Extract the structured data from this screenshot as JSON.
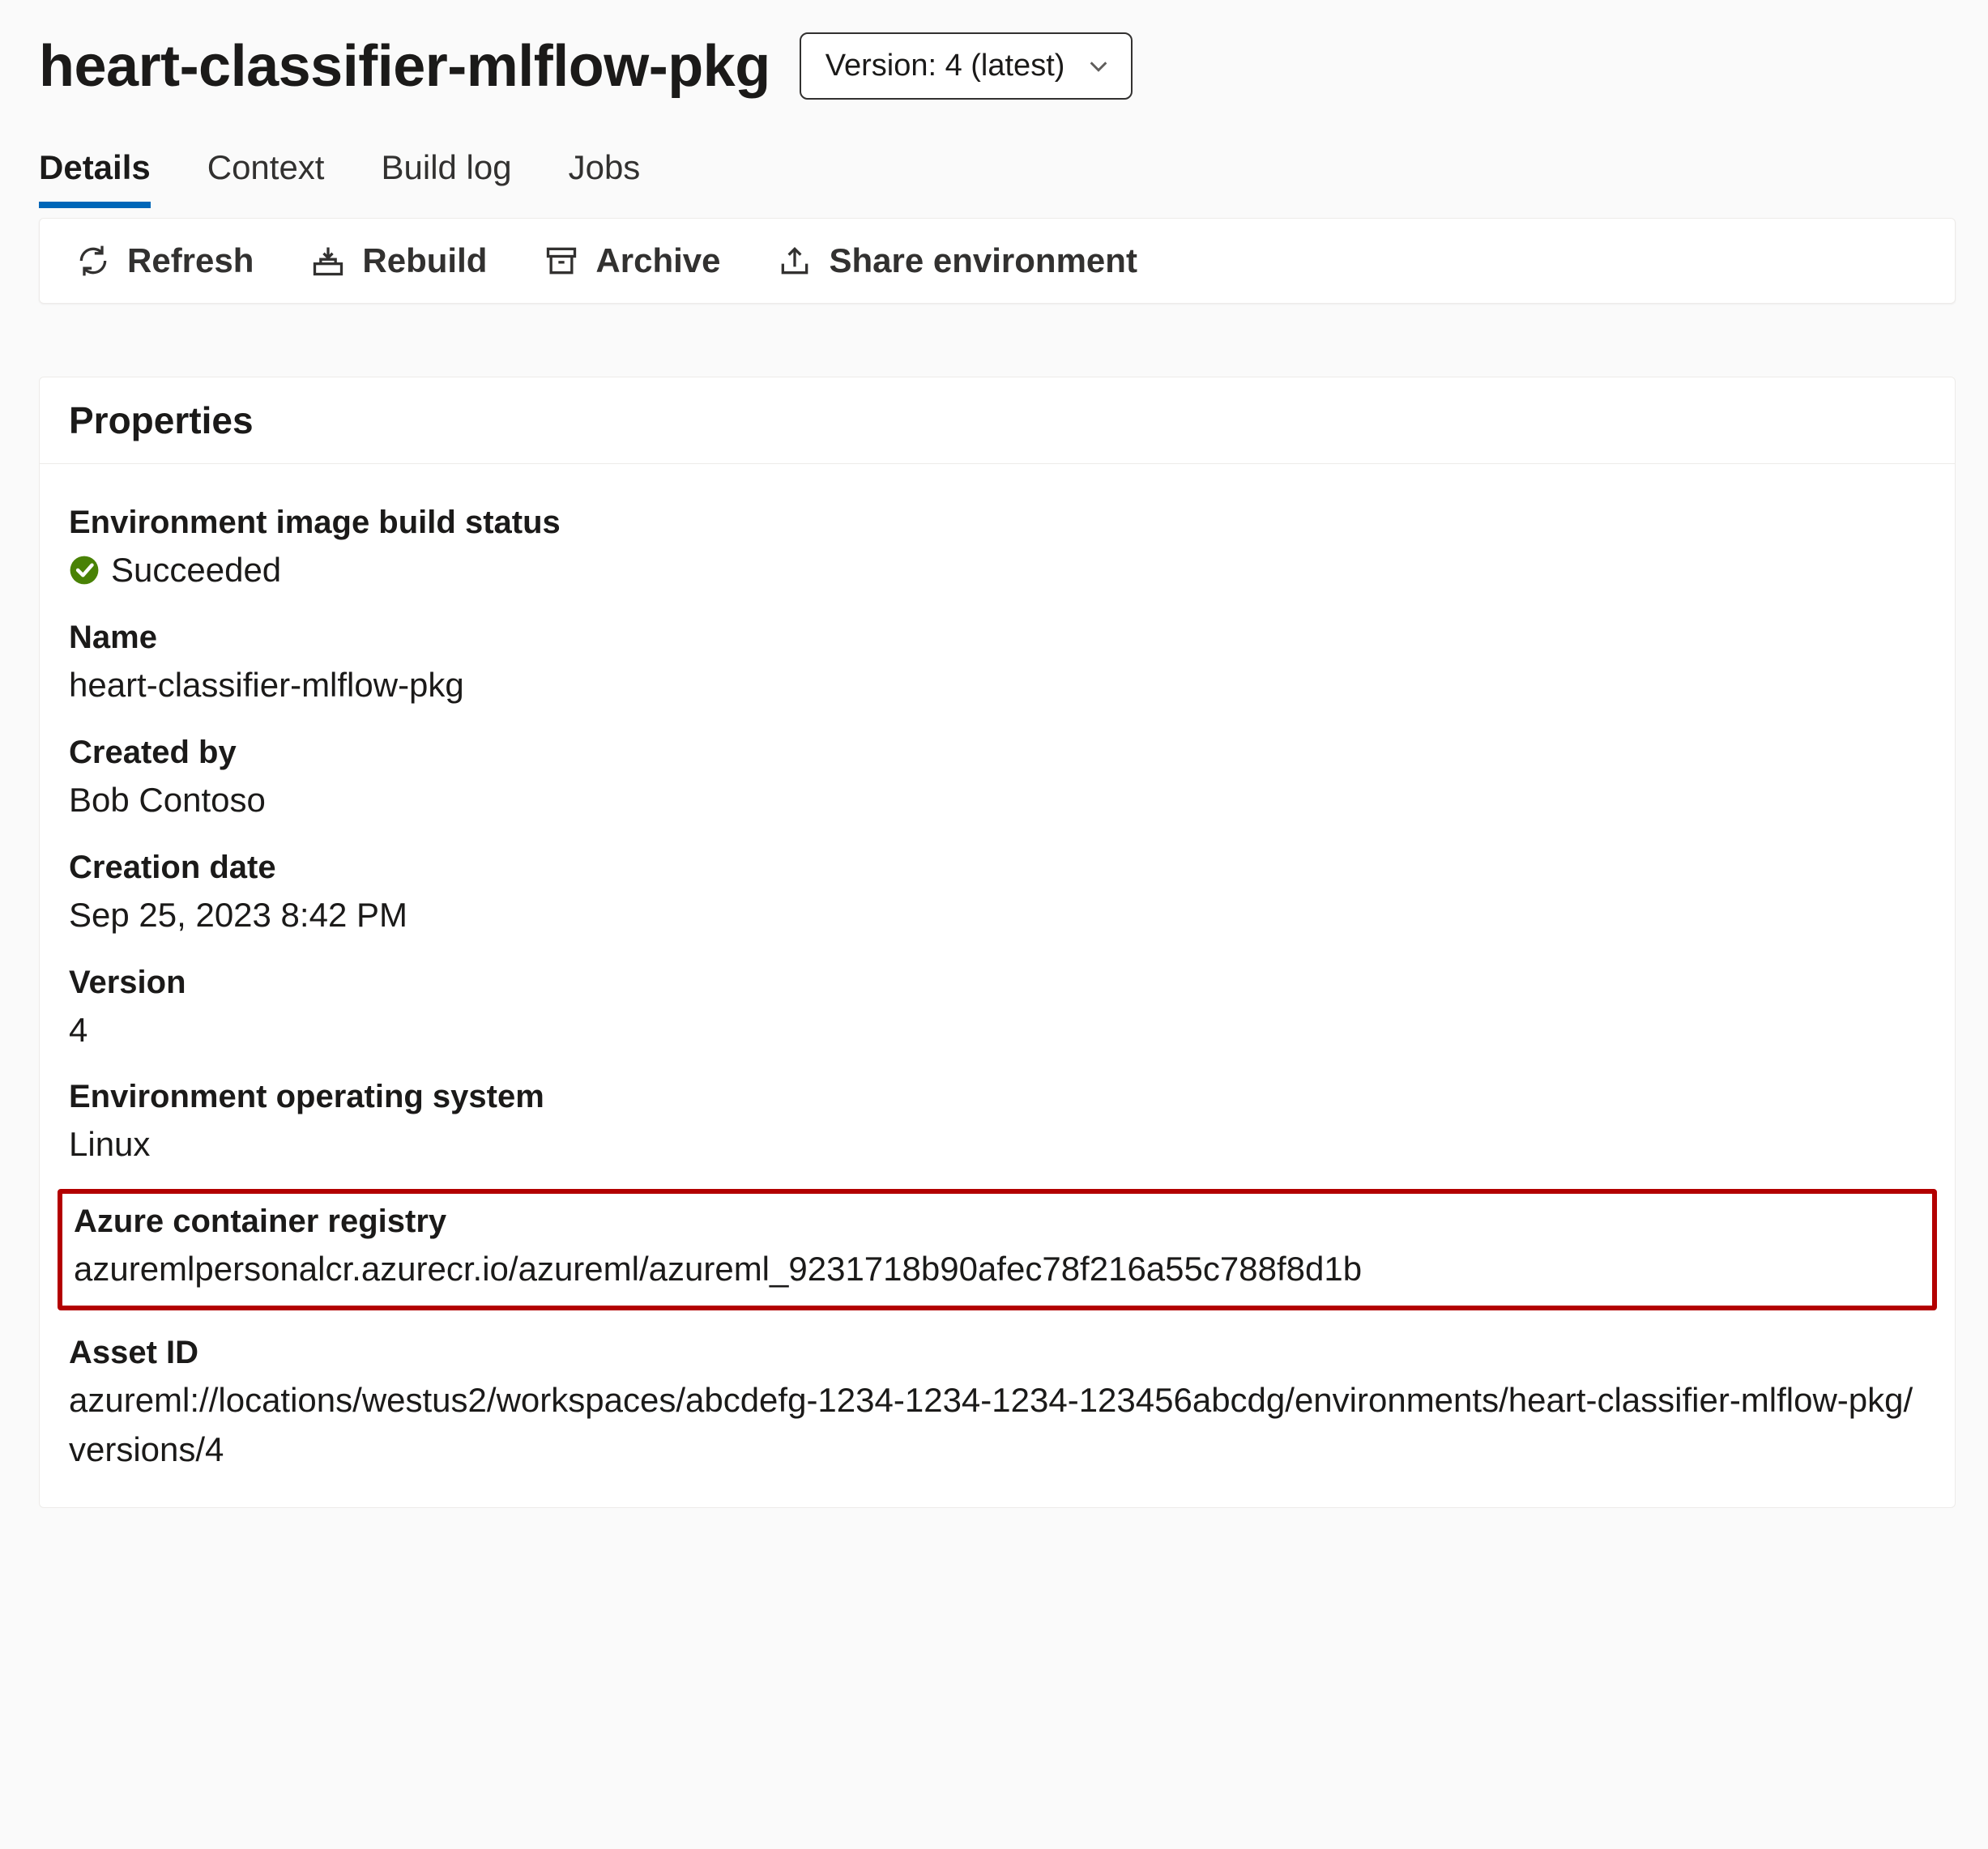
{
  "header": {
    "title": "heart-classifier-mlflow-pkg",
    "version_selector_label": "Version: 4 (latest)"
  },
  "tabs": [
    {
      "label": "Details",
      "active": true
    },
    {
      "label": "Context",
      "active": false
    },
    {
      "label": "Build log",
      "active": false
    },
    {
      "label": "Jobs",
      "active": false
    }
  ],
  "toolbar": {
    "refresh": "Refresh",
    "rebuild": "Rebuild",
    "archive": "Archive",
    "share": "Share environment"
  },
  "properties": {
    "card_title": "Properties",
    "build_status_label": "Environment image build status",
    "build_status_value": "Succeeded",
    "name_label": "Name",
    "name_value": "heart-classifier-mlflow-pkg",
    "created_by_label": "Created by",
    "created_by_value": "Bob Contoso",
    "creation_date_label": "Creation date",
    "creation_date_value": "Sep 25, 2023 8:42 PM",
    "version_label": "Version",
    "version_value": "4",
    "os_label": "Environment operating system",
    "os_value": "Linux",
    "acr_label": "Azure container registry",
    "acr_value": "azuremlpersonalcr.azurecr.io/azureml/azureml_9231718b90afec78f216a55c788f8d1b",
    "asset_id_label": "Asset ID",
    "asset_id_value": "azureml://locations/westus2/workspaces/abcdefg-1234-1234-1234-123456abcdg/environments/heart-classifier-mlflow-pkg/versions/4"
  }
}
